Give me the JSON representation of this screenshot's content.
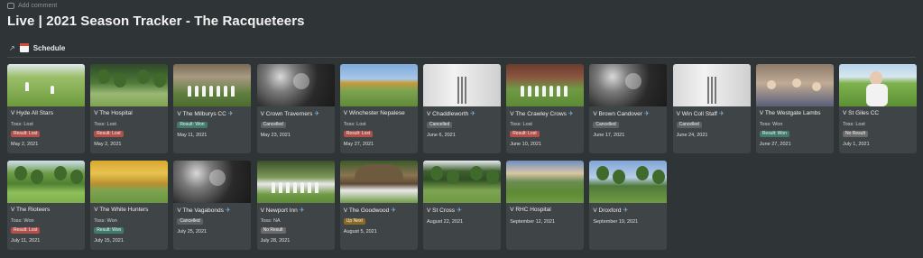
{
  "topbar": {
    "add_comment": "Add comment"
  },
  "page": {
    "title": "Live | 2021 Season Tracker  - The Racqueteers"
  },
  "view": {
    "name": "Schedule",
    "link_icon": "arrow-up-right-icon",
    "view_icon": "calendar-icon"
  },
  "colors": {
    "lost": "#b24f4a",
    "won": "#3f7a6a",
    "cancelled": "#5c6165",
    "no_result": "#6b6b6b",
    "up_next": "#8a6a22"
  },
  "cards": [
    {
      "title": "V Hyde All Stars",
      "plane": false,
      "toss": "Toss: Lost",
      "badge": "Result: Lost",
      "badge_type": "lost",
      "date": "May 2, 2021",
      "thumb": "hyde"
    },
    {
      "title": "V The Hospital",
      "plane": false,
      "toss": "Toss: Lost",
      "badge": "Result: Lost",
      "badge_type": "lost",
      "date": "May 2, 2021",
      "thumb": "hospital"
    },
    {
      "title": "V The Milburys CC",
      "plane": true,
      "toss": "",
      "badge": "Result: Won",
      "badge_type": "won",
      "date": "May 11, 2021",
      "thumb": "milbury"
    },
    {
      "title": "V Crown Traverners",
      "plane": true,
      "toss": "",
      "badge": "Cancelled",
      "badge_type": "cancelled",
      "date": "May 23, 2021",
      "thumb": "rain"
    },
    {
      "title": "V Winchester Nepalese",
      "plane": false,
      "toss": "Toss: Lost",
      "badge": "Result: Lost",
      "badge_type": "lost",
      "date": "May 27, 2021",
      "thumb": "winch"
    },
    {
      "title": "V Chaddleworth",
      "plane": true,
      "toss": "",
      "badge": "Cancelled",
      "badge_type": "cancelled",
      "date": "June 6, 2021",
      "thumb": "stumps"
    },
    {
      "title": "V The Crawley Crows",
      "plane": true,
      "toss": "Toss: Lost",
      "badge": "Result: Lost",
      "badge_type": "lost",
      "date": "June 10, 2021",
      "thumb": "crawley"
    },
    {
      "title": "V Brown Candover",
      "plane": true,
      "toss": "",
      "badge": "Cancelled",
      "badge_type": "cancelled",
      "date": "June 17, 2021",
      "thumb": "rain"
    },
    {
      "title": "V Win Coll Staff",
      "plane": true,
      "toss": "",
      "badge": "Cancelled",
      "badge_type": "cancelled",
      "date": "June 24, 2021",
      "thumb": "stumps"
    },
    {
      "title": "V The Westgate Lambs",
      "plane": false,
      "toss": "Toss: Won",
      "badge": "Result: Won",
      "badge_type": "won",
      "date": "June 27, 2021",
      "thumb": "westgate"
    },
    {
      "title": "V St Giles CC",
      "plane": false,
      "toss": "Toss: Lost",
      "badge": "No Result",
      "badge_type": "no_result",
      "date": "July 1, 2021",
      "thumb": "stgiles"
    },
    {
      "title": "V The Rioteers",
      "plane": false,
      "toss": "Toss: Won",
      "badge": "Result: Lost",
      "badge_type": "lost",
      "date": "July 11, 2021",
      "thumb": "rioteers"
    },
    {
      "title": "V The White Hunters",
      "plane": false,
      "toss": "Toss: Won",
      "badge": "Result: Won",
      "badge_type": "won",
      "date": "July 15, 2021",
      "thumb": "white"
    },
    {
      "title": "V The Vagabonds",
      "plane": true,
      "toss": "",
      "badge": "Cancelled",
      "badge_type": "cancelled",
      "date": "July 25, 2021",
      "thumb": "rain"
    },
    {
      "title": "V Newport Inn",
      "plane": true,
      "toss": "Toss: NA",
      "badge": "No Result",
      "badge_type": "no_result",
      "date": "July 28, 2021",
      "thumb": "newport"
    },
    {
      "title": "V The Goodwood",
      "plane": true,
      "toss": "",
      "badge": "Up Next",
      "badge_type": "up_next",
      "date": "August 5, 2021",
      "thumb": "goodwood"
    },
    {
      "title": "V St Cross",
      "plane": true,
      "toss": "",
      "badge": "",
      "badge_type": "",
      "date": "August 22, 2021",
      "thumb": "stcross"
    },
    {
      "title": "V RHC Hospital",
      "plane": false,
      "toss": "",
      "badge": "",
      "badge_type": "",
      "date": "September 12, 2021",
      "thumb": "rhc"
    },
    {
      "title": "V Droxford",
      "plane": true,
      "toss": "",
      "badge": "",
      "badge_type": "",
      "date": "September 19, 2021",
      "thumb": "droxford"
    }
  ]
}
